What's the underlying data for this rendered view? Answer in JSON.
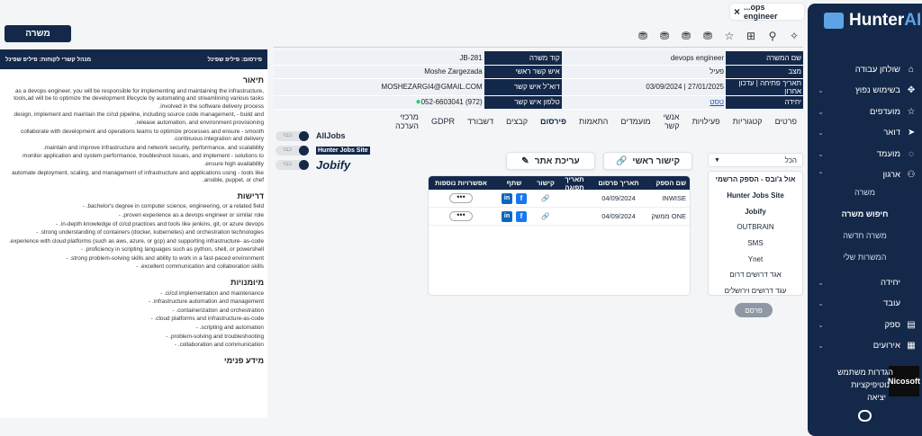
{
  "app": {
    "brand_text": "Hunter",
    "brand_accent": "AI"
  },
  "browser_tab": {
    "close": "×",
    "label": "...ops engineer"
  },
  "toolbar": {
    "icons": [
      "bulb-icon",
      "user-lock-icon",
      "star-icon",
      "add-folder-icon",
      "money-icon-1",
      "money-icon-2",
      "money-icon-3",
      "money-icon-4"
    ]
  },
  "page_title_button": "משרה",
  "sidebar": {
    "items": [
      {
        "label": "שולחן עבודה",
        "icon": "⌂",
        "chev": ""
      },
      {
        "label": "בשימוש נפוץ",
        "icon": "✥",
        "chev": "⌄"
      },
      {
        "label": "מועדפים",
        "icon": "☆",
        "chev": "⌄"
      },
      {
        "label": "דואר",
        "icon": "➤",
        "chev": "⌄"
      },
      {
        "label": "מועמד",
        "icon": "◌",
        "chev": "⌄"
      },
      {
        "label": "ארגון",
        "icon": "⚇",
        "chev": "⌃"
      }
    ],
    "subitems": [
      "משרה",
      "חיפוש משרה",
      "משרה חדשה",
      "המשרות שלי"
    ],
    "more_items": [
      {
        "label": "יחידה",
        "icon": "",
        "chev": "⌄"
      },
      {
        "label": "עובד",
        "icon": "",
        "chev": "⌄"
      },
      {
        "label": "ספק",
        "icon": "▤",
        "chev": "⌄"
      },
      {
        "label": "אירועים",
        "icon": "▦",
        "chev": "⌄"
      }
    ],
    "user": {
      "line1": "הגדרות משתמש",
      "line2": "נוטיפיקציות",
      "line3": "יציאה",
      "avatar": "Nicosoft"
    }
  },
  "details": {
    "rows": [
      {
        "k1": "שם המשרה",
        "v1": "devops engineer",
        "k2": "קוד משרה",
        "v2": "JB-281"
      },
      {
        "k1": "מצב",
        "v1": "פעיל",
        "k2": "איש קשר ראשי",
        "v2": "Moshe Zargezada"
      },
      {
        "k1": "תאריך פתיחה | עדכון אחרון",
        "v1": "27/01/2025 | 03/09/2024",
        "k2": "דוא\"ל איש קשר",
        "v2": "MOSHEZARGI4@GMAIL.COM"
      },
      {
        "k1": "יחידה",
        "v1": "טסט",
        "k2": "טלפון איש קשר",
        "v2": "(972) 052-6603041"
      }
    ]
  },
  "tabs": [
    "פרטים",
    "קטגוריות",
    "פעילויות",
    "אנשי קשר",
    "מועמדים",
    "התאמות",
    "פירסום",
    "קבצים",
    "דשבורד",
    "GDPR",
    "מרכזי הערכה"
  ],
  "publish": {
    "select_value": "הכל",
    "suppliers": [
      "אול ג'ובס - הספק הרשמי",
      "Hunter Jobs Site",
      "Jobify",
      "OUTBRAIN",
      "SMS",
      "Ynet",
      "אגד דרושים דרום",
      "עגד דרושים וירושלים"
    ],
    "button": "פרסם"
  },
  "actions": {
    "main_link": "קישור ראשי",
    "edit_site": "עריכת אתר"
  },
  "grid": {
    "headers": [
      "שם הספק",
      "תאריך פרסום",
      "תאריך תפוגה",
      "קישור",
      "שתף",
      "אפשרויות נוספות"
    ],
    "rows": [
      {
        "supplier": "INWISE",
        "date": "04/09/2024",
        "expire": ""
      },
      {
        "supplier": "ONE ממשק",
        "date": "04/09/2024",
        "expire": ""
      }
    ]
  },
  "boards": [
    {
      "name": "AllJobs",
      "toggle": "כבוי"
    },
    {
      "name": "Hunter Jobs Site",
      "toggle": "כבוי"
    },
    {
      "name": "Jobify",
      "toggle": "כבוי"
    }
  ],
  "left_panel": {
    "head_left": "פירסום: פיליפ שפינל",
    "head_right": "מנהל קשרי לקוחות: פיליפ שפינל",
    "desc_title": "תיאור",
    "desc": [
      "as a devops engineer, you will be responsible for implementing and maintaining the infrastructure, tools,ad will be to optimize the development lifecycle by automating and streamlining various tasks involved in the software delivery process.",
      "design, implement and maintain the ci/cd pipeline, including source code management, - build and release automation, and environment provisioning.",
      "collaborate with development and operations teams to optimize processes and ensure - smooth continuous integration and delivery.",
      "maintain and improve infrastructure and network security, performance, and scalability.",
      "monitor application and system performance, troubleshoot issues, and implement - solutions to ensure high availability.",
      "automate deployment, scaling, and management of infrastructure and applications using - tools like ansible, puppet, or chef."
    ],
    "req_title": "דרישות",
    "reqs": [
      "bachelor's degree in computer science, engineering, or a related field. -",
      "proven experience as a devops engineer or similar role. -",
      "in-depth knowledge of ci/cd practices and tools like jenkins, git, or azure devops. -",
      "strong understanding of containers (docker, kubernetes) and orchestration technologies. -",
      "experience with cloud platforms (such as aws, azure, or gcp) and supporting infrastructure- as-code.",
      "proficiency in scripting languages such as python, shell, or powershell. -",
      "strong problem-solving skills and ability to work in a fast-paced environment. -",
      "excellent communication and collaboration skills. -"
    ],
    "skills_title": "מיומנויות",
    "skills": [
      "ci/cd implementation and maintenance. -",
      "infrastructure automation and management. -",
      "containerization and orchestration. -",
      "cloud platforms and infrastructure-as-code. -",
      "scripting and automation. -",
      "problem-solving and troubleshooting. -",
      "collaboration and communication. -"
    ],
    "internal_title": "מידע פנימי"
  }
}
